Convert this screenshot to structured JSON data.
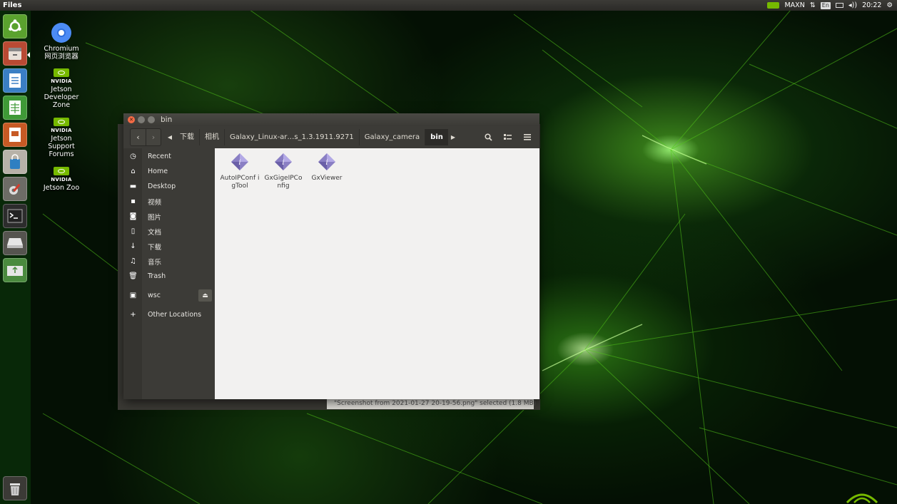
{
  "top_panel": {
    "app_title": "Files",
    "power_mode": "MAXN",
    "keyboard_layout": "En",
    "clock": "20:22"
  },
  "launcher": {
    "items": [
      {
        "name": "ubuntu-dash",
        "icon": "ubuntu-logo-icon"
      },
      {
        "name": "files",
        "icon": "file-cabinet-icon"
      },
      {
        "name": "libreoffice-writer",
        "icon": "writer-document-icon"
      },
      {
        "name": "libreoffice-calc",
        "icon": "spreadsheet-icon"
      },
      {
        "name": "libreoffice-impress",
        "icon": "presentation-icon"
      },
      {
        "name": "software-center",
        "icon": "shopping-bag-icon"
      },
      {
        "name": "system-settings",
        "icon": "settings-wrench-icon"
      },
      {
        "name": "terminal",
        "icon": "terminal-icon"
      },
      {
        "name": "disk-drive",
        "icon": "disk-drive-icon"
      },
      {
        "name": "usb-drive",
        "icon": "usb-drive-icon"
      },
      {
        "name": "trash",
        "icon": "trash-icon"
      }
    ]
  },
  "desktop_icons": [
    {
      "line1": "Chromium",
      "line2": "网页浏览器",
      "line3": ""
    },
    {
      "brand": "NVIDIA",
      "line1": "Jetson",
      "line2": "Developer",
      "line3": "Zone"
    },
    {
      "brand": "NVIDIA",
      "line1": "Jetson",
      "line2": "Support",
      "line3": "Forums"
    },
    {
      "brand": "NVIDIA",
      "line1": "Jetson Zoo",
      "line2": "",
      "line3": ""
    }
  ],
  "window": {
    "title": "bin",
    "breadcrumbs": [
      "下载",
      "相机",
      "Galaxy_Linux-ar…s_1.3.1911.9271",
      "Galaxy_camera",
      "bin"
    ],
    "sidebar": [
      {
        "label": "Recent",
        "icon": "clock-icon"
      },
      {
        "label": "Home",
        "icon": "home-icon"
      },
      {
        "label": "Desktop",
        "icon": "folder-icon"
      },
      {
        "label": "视频",
        "icon": "video-icon"
      },
      {
        "label": "图片",
        "icon": "camera-icon"
      },
      {
        "label": "文档",
        "icon": "document-icon"
      },
      {
        "label": "下载",
        "icon": "download-icon"
      },
      {
        "label": "音乐",
        "icon": "music-icon"
      },
      {
        "label": "Trash",
        "icon": "trash-icon"
      },
      {
        "label": "wsc",
        "icon": "drive-icon"
      },
      {
        "label": "Other Locations",
        "icon": "plus-icon"
      }
    ],
    "files": [
      {
        "name": "AutoIPConfigTool",
        "display": "AutoIPConf igTool",
        "icon": "executable-diamond-icon"
      },
      {
        "name": "GxGigeIPConfig",
        "display": "GxGigeIPCo nfig",
        "icon": "executable-diamond-icon"
      },
      {
        "name": "GxViewer",
        "display": "GxViewer",
        "icon": "executable-diamond-icon"
      }
    ]
  },
  "status_bar": {
    "text": "\"Screenshot from 2021-01-27 20-19-56.png\" selected  (1.8 MB)"
  },
  "colors": {
    "accent_orange": "#f46b45",
    "nvidia_green": "#76b900",
    "window_dark": "#3c3b37",
    "content_bg": "#f2f1f0"
  }
}
